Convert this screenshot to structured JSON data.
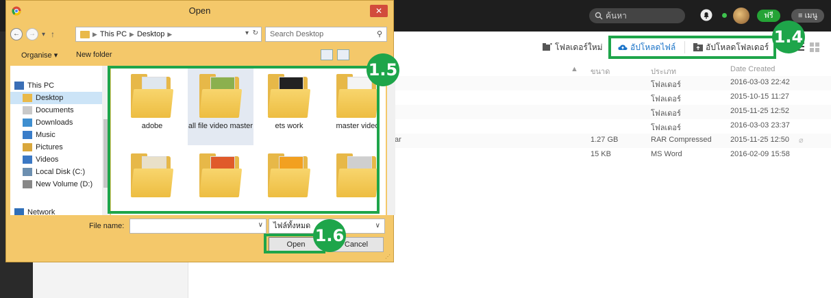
{
  "web": {
    "search_placeholder": "ค้นหา",
    "free_badge": "ฟรี",
    "menu_label": "เมนู",
    "toolbar": {
      "new_folder": "โฟลเดอร์ใหม่",
      "upload_file": "อัปโหลดไฟล์",
      "upload_folder": "อัปโหลดโฟลเดอร์"
    },
    "columns": {
      "size": "ขนาด",
      "type": "ประเภท",
      "date_created": "Date Created"
    },
    "rows": [
      {
        "name": "",
        "size": "",
        "type": "โฟลเดอร์",
        "date": "2016-03-03 22:42"
      },
      {
        "name": "",
        "size": "",
        "type": "โฟลเดอร์",
        "date": "2015-10-15 11:27"
      },
      {
        "name": "",
        "size": "",
        "type": "โฟลเดอร์",
        "date": "2015-11-25 12:52"
      },
      {
        "name": "",
        "size": "",
        "type": "โฟลเดอร์",
        "date": "2016-03-03 23:37"
      },
      {
        "name": "ar",
        "size": "1.27 GB",
        "type": "RAR Compressed",
        "date": "2015-11-25 12:50"
      },
      {
        "name": "",
        "size": "15 KB",
        "type": "MS Word",
        "date": "2016-02-09 15:58"
      }
    ]
  },
  "steps": {
    "s14": "1.4",
    "s15": "1.5",
    "s16": "1.6"
  },
  "dialog": {
    "title": "Open",
    "close": "✕",
    "address": {
      "this_pc": "This PC",
      "desktop": "Desktop"
    },
    "search_placeholder": "Search Desktop",
    "organise": "Organise ▾",
    "new_folder": "New folder",
    "nav_items": [
      {
        "label": "This PC"
      },
      {
        "label": "Desktop"
      },
      {
        "label": "Documents"
      },
      {
        "label": "Downloads"
      },
      {
        "label": "Music"
      },
      {
        "label": "Pictures"
      },
      {
        "label": "Videos"
      },
      {
        "label": "Local Disk (C:)"
      },
      {
        "label": "New Volume (D:)"
      },
      {
        "label": "Network"
      }
    ],
    "files": [
      {
        "label": "adobe"
      },
      {
        "label": "all file video master"
      },
      {
        "label": "ets work"
      },
      {
        "label": "master video"
      },
      {
        "label": ""
      },
      {
        "label": ""
      },
      {
        "label": ""
      },
      {
        "label": ""
      }
    ],
    "file_name_label": "File name:",
    "file_name_value": "",
    "filter": "ไฟล์ทั้งหมด",
    "open_label": "Open",
    "cancel_label": "Cancel"
  },
  "colors": {
    "accent_green": "#1ea54a",
    "dialog_frame": "#f4c86a",
    "upload_blue": "#1a73c8"
  }
}
